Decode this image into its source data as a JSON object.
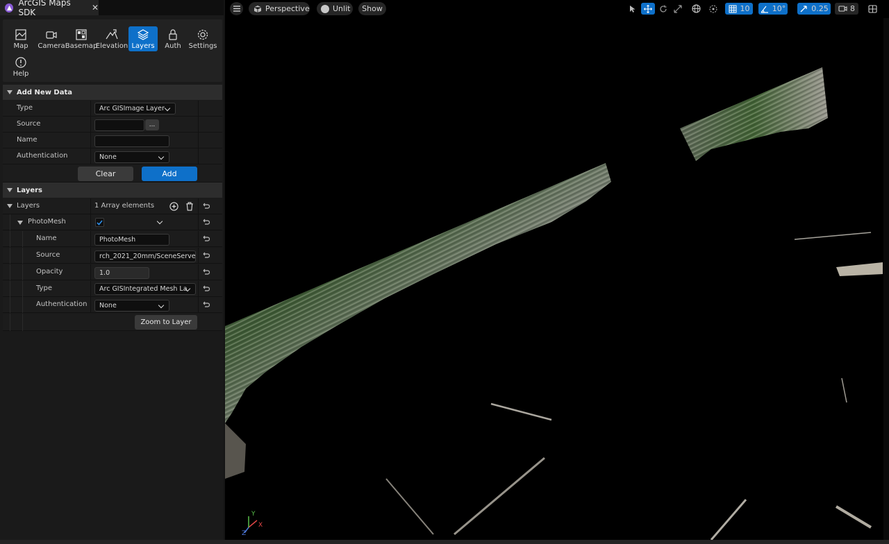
{
  "window": {
    "tab_title": "ArcGIS Maps SDK",
    "close_glyph": "✕"
  },
  "toolbar": {
    "items": [
      {
        "label": "Map",
        "icon": "map-icon"
      },
      {
        "label": "Camera",
        "icon": "camera-icon"
      },
      {
        "label": "Basemap",
        "icon": "basemap-icon"
      },
      {
        "label": "Elevation",
        "icon": "elevation-icon"
      },
      {
        "label": "Layers",
        "icon": "layers-icon",
        "active": true
      },
      {
        "label": "Auth",
        "icon": "lock-icon"
      },
      {
        "label": "Settings",
        "icon": "gear-icon"
      },
      {
        "label": "Help",
        "icon": "help-icon"
      }
    ]
  },
  "add_new_data": {
    "title": "Add New Data",
    "type_label": "Type",
    "type_value": "Arc GISImage Layer",
    "source_label": "Source",
    "source_value": "",
    "browse_label": "...",
    "name_label": "Name",
    "name_value": "",
    "auth_label": "Authentication",
    "auth_value": "None",
    "clear_label": "Clear",
    "add_label": "Add"
  },
  "layers": {
    "section_title": "Layers",
    "array_label": "Layers",
    "array_count": "1 Array elements",
    "item": {
      "title": "PhotoMesh",
      "visible": true,
      "name_label": "Name",
      "name_value": "PhotoMesh",
      "source_label": "Source",
      "source_value": "rch_2021_20mm/SceneServe",
      "opacity_label": "Opacity",
      "opacity_value": "1.0",
      "type_label": "Type",
      "type_value": "Arc GISIntegrated Mesh La",
      "auth_label": "Authentication",
      "auth_value": "None",
      "zoom_label": "Zoom to Layer"
    }
  },
  "viewport": {
    "perspective_label": "Perspective",
    "unlit_label": "Unlit",
    "show_label": "Show",
    "grid_snap": "10",
    "rotation_snap": "10°",
    "scale_snap": "0.25",
    "camera_speed": "8",
    "axis_x": "X",
    "axis_y": "Y",
    "axis_z": "Z"
  },
  "colors": {
    "accent": "#0e70c9",
    "panel": "#1a1a1a",
    "viewport": "#000000"
  }
}
